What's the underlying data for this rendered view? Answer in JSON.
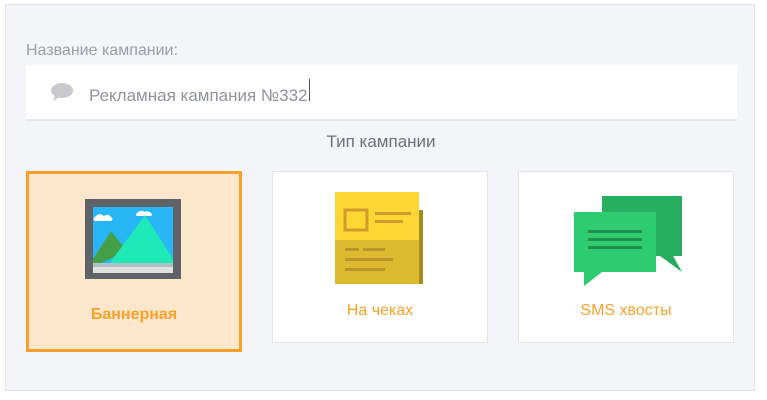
{
  "campaign_form": {
    "name_label": "Название кампании:",
    "name_value": "Рекламная кампания №332",
    "type_title": "Тип кампании"
  },
  "campaign_types": [
    {
      "label": "Баннерная",
      "icon": "banner-image-icon",
      "selected": true
    },
    {
      "label": "На чеках",
      "icon": "receipt-icon",
      "selected": false
    },
    {
      "label": "SMS хвосты",
      "icon": "sms-chat-icon",
      "selected": false
    }
  ],
  "colors": {
    "accent": "#f7a12b",
    "selected_bg": "#fde7cc",
    "panel_bg": "#f4f5f8",
    "receipt_yellow": "#fdd835",
    "sms_green": "#2ecc71"
  }
}
